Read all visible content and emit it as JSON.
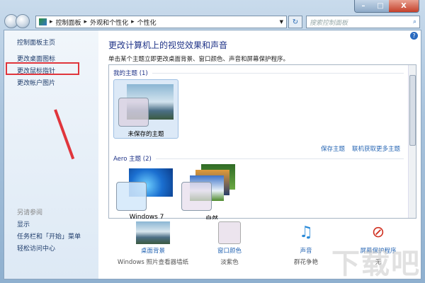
{
  "window": {
    "minimize": "–",
    "maximize": "□",
    "close": "X"
  },
  "address": {
    "crumbs": [
      "控制面板",
      "外观和个性化",
      "个性化"
    ],
    "search_placeholder": "搜索控制面板"
  },
  "sidebar": {
    "items": [
      "控制面板主页",
      "更改桌面图标",
      "更改鼠标指针",
      "更改帐户图片"
    ],
    "see_also_title": "另请参阅",
    "see_also": [
      "显示",
      "任务栏和「开始」菜单",
      "轻松访问中心"
    ]
  },
  "main": {
    "title": "更改计算机上的视觉效果和声音",
    "subtitle": "单击某个主题立即更改桌面背景、窗口颜色、声音和屏幕保护程序。",
    "my_themes": {
      "header": "我的主题 (1)",
      "items": [
        "未保存的主题"
      ]
    },
    "save_theme": "保存主题",
    "get_more": "联机获取更多主题",
    "aero_themes": {
      "header": "Aero 主题 (2)",
      "items": [
        "Windows 7",
        "自然"
      ]
    }
  },
  "bottom": [
    {
      "label": "桌面背景",
      "value": "Windows 照片查看器墙纸"
    },
    {
      "label": "窗口颜色",
      "value": "淡紫色"
    },
    {
      "label": "声音",
      "value": "群花争艳"
    },
    {
      "label": "屏幕保护程序",
      "value": "无"
    }
  ],
  "watermark": "下载吧"
}
